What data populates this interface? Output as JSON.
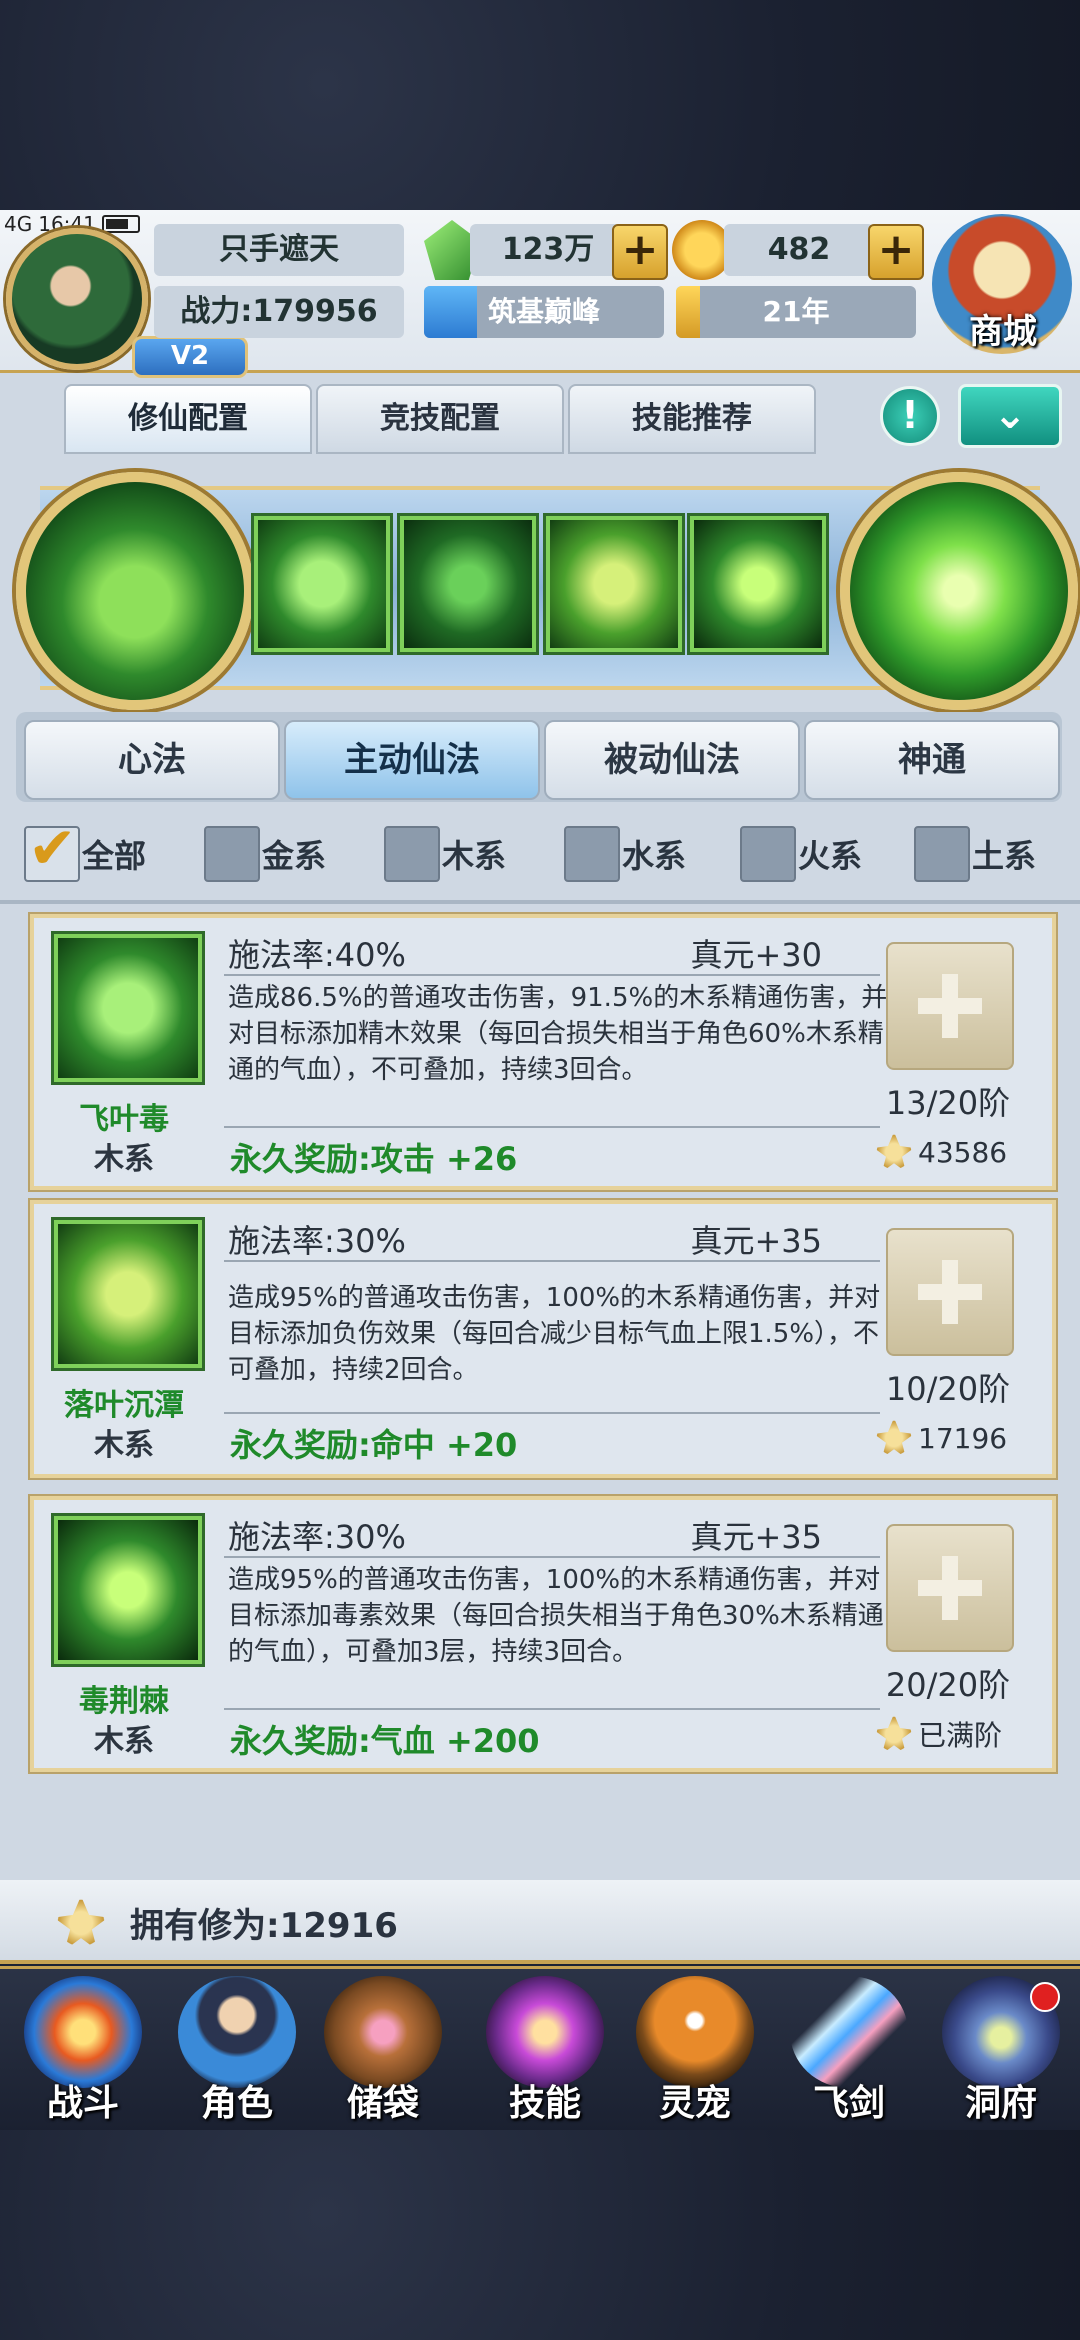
{
  "status_bar": {
    "network": "4G",
    "time": "16:41"
  },
  "player": {
    "name": "只手遮天",
    "power_label": "战力:179956",
    "vip": "V2"
  },
  "currency": {
    "spirit_stones": "123万",
    "gold": "482"
  },
  "realm": {
    "label": "筑基巅峰",
    "progress": 0.22
  },
  "age": {
    "label": "21年",
    "progress": 0.1
  },
  "shop": {
    "label": "商城"
  },
  "config_tabs": [
    "修仙配置",
    "竞技配置",
    "技能推荐"
  ],
  "info_button": "!",
  "skill_categories": [
    "心法",
    "主动仙法",
    "被动仙法",
    "神通"
  ],
  "active_category": "主动仙法",
  "filters": [
    {
      "label": "全部",
      "checked": true
    },
    {
      "label": "金系",
      "checked": false
    },
    {
      "label": "木系",
      "checked": false
    },
    {
      "label": "水系",
      "checked": false
    },
    {
      "label": "火系",
      "checked": false
    },
    {
      "label": "土系",
      "checked": false
    }
  ],
  "skills": [
    {
      "name": "飞叶毒",
      "element": "木系",
      "cast_rate": "施法率:40%",
      "cost": "真元+30",
      "description": "造成86.5%的普通攻击伤害，91.5%的木系精通伤害，并对目标添加精木效果（每回合损失相当于角色60%木系精通的气血），不可叠加，持续3回合。",
      "bonus": "永久奖励:攻击  +26",
      "level": "13/20阶",
      "upgrade_cost": "43586"
    },
    {
      "name": "落叶沉潭",
      "element": "木系",
      "cast_rate": "施法率:30%",
      "cost": "真元+35",
      "description": "造成95%的普通攻击伤害，100%的木系精通伤害，并对目标添加负伤效果（每回合减少目标气血上限1.5%），不可叠加，持续2回合。",
      "bonus": "永久奖励:命中  +20",
      "level": "10/20阶",
      "upgrade_cost": "17196"
    },
    {
      "name": "毒荆棘",
      "element": "木系",
      "cast_rate": "施法率:30%",
      "cost": "真元+35",
      "description": "造成95%的普通攻击伤害，100%的木系精通伤害，并对目标添加毒素效果（每回合损失相当于角色30%木系精通的气血），可叠加3层，持续3回合。",
      "bonus": "永久奖励:气血  +200",
      "level": "20/20阶",
      "upgrade_cost": "已满阶"
    }
  ],
  "cultivation": {
    "label": "拥有修为:12916"
  },
  "nav": [
    "战斗",
    "角色",
    "储袋",
    "技能",
    "灵宠",
    "飞剑",
    "洞府"
  ]
}
